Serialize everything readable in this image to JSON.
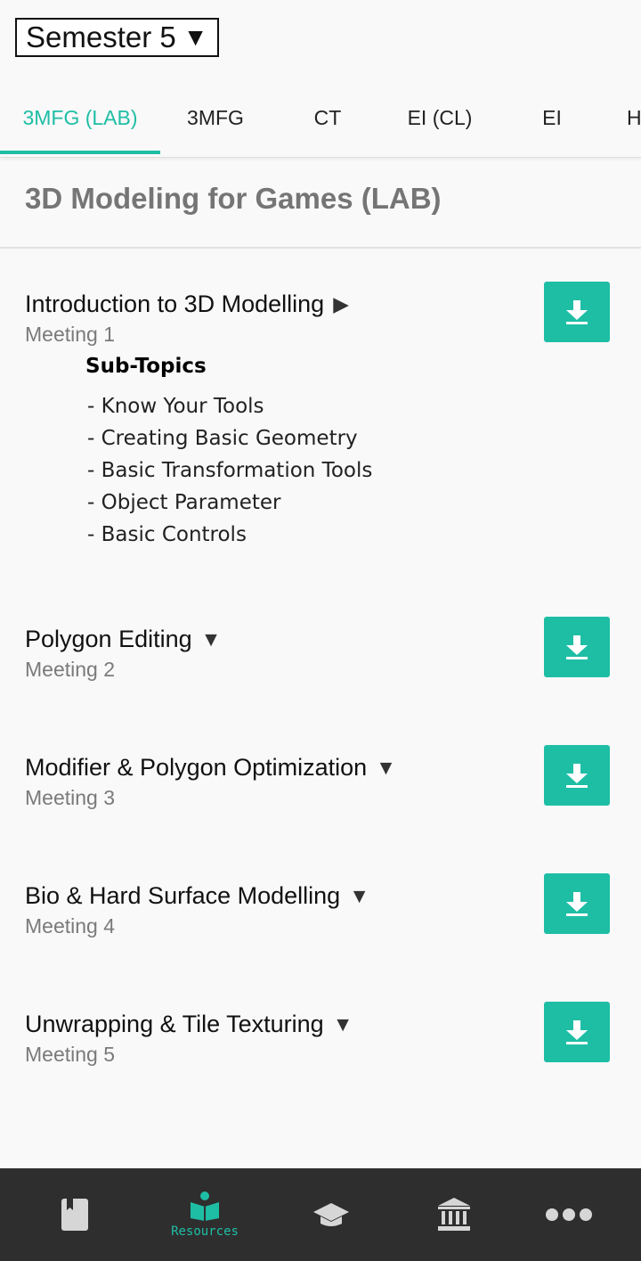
{
  "semester": {
    "label": "Semester 5",
    "caret": "▼"
  },
  "tabs": [
    {
      "label": "3MFG (LAB)",
      "active": true
    },
    {
      "label": "3MFG"
    },
    {
      "label": "CT"
    },
    {
      "label": "EI (CL)"
    },
    {
      "label": "EI"
    },
    {
      "label": "H"
    }
  ],
  "course": {
    "title": "3D Modeling for Games (LAB)"
  },
  "meetings": [
    {
      "title": "Introduction to 3D Modelling",
      "caret": "▶",
      "meeting": "Meeting 1"
    },
    {
      "title": "Polygon Editing",
      "caret": "▼",
      "meeting": "Meeting 2"
    },
    {
      "title": "Modifier & Polygon Optimization",
      "caret": "▼",
      "meeting": "Meeting 3"
    },
    {
      "title": "Bio & Hard Surface Modelling",
      "caret": "▼",
      "meeting": "Meeting 4"
    },
    {
      "title": "Unwrapping & Tile Texturing",
      "caret": "▼",
      "meeting": "Meeting 5"
    }
  ],
  "subtopics": {
    "heading": "Sub-Topics",
    "items": [
      "- Know Your Tools",
      "- Creating Basic Geometry",
      "- Basic Transformation Tools",
      "- Object Parameter",
      "- Basic Controls"
    ]
  },
  "bottom_nav": {
    "items": [
      {
        "icon": "book-icon"
      },
      {
        "icon": "reader-icon",
        "label": "Resources",
        "active": true
      },
      {
        "icon": "graduation-cap-icon"
      },
      {
        "icon": "institution-icon"
      },
      {
        "icon": "more-icon"
      }
    ]
  },
  "colors": {
    "accent": "#1ebea5",
    "nav_bg": "#2e2e2e",
    "icon_inactive": "#d6d6d6"
  }
}
